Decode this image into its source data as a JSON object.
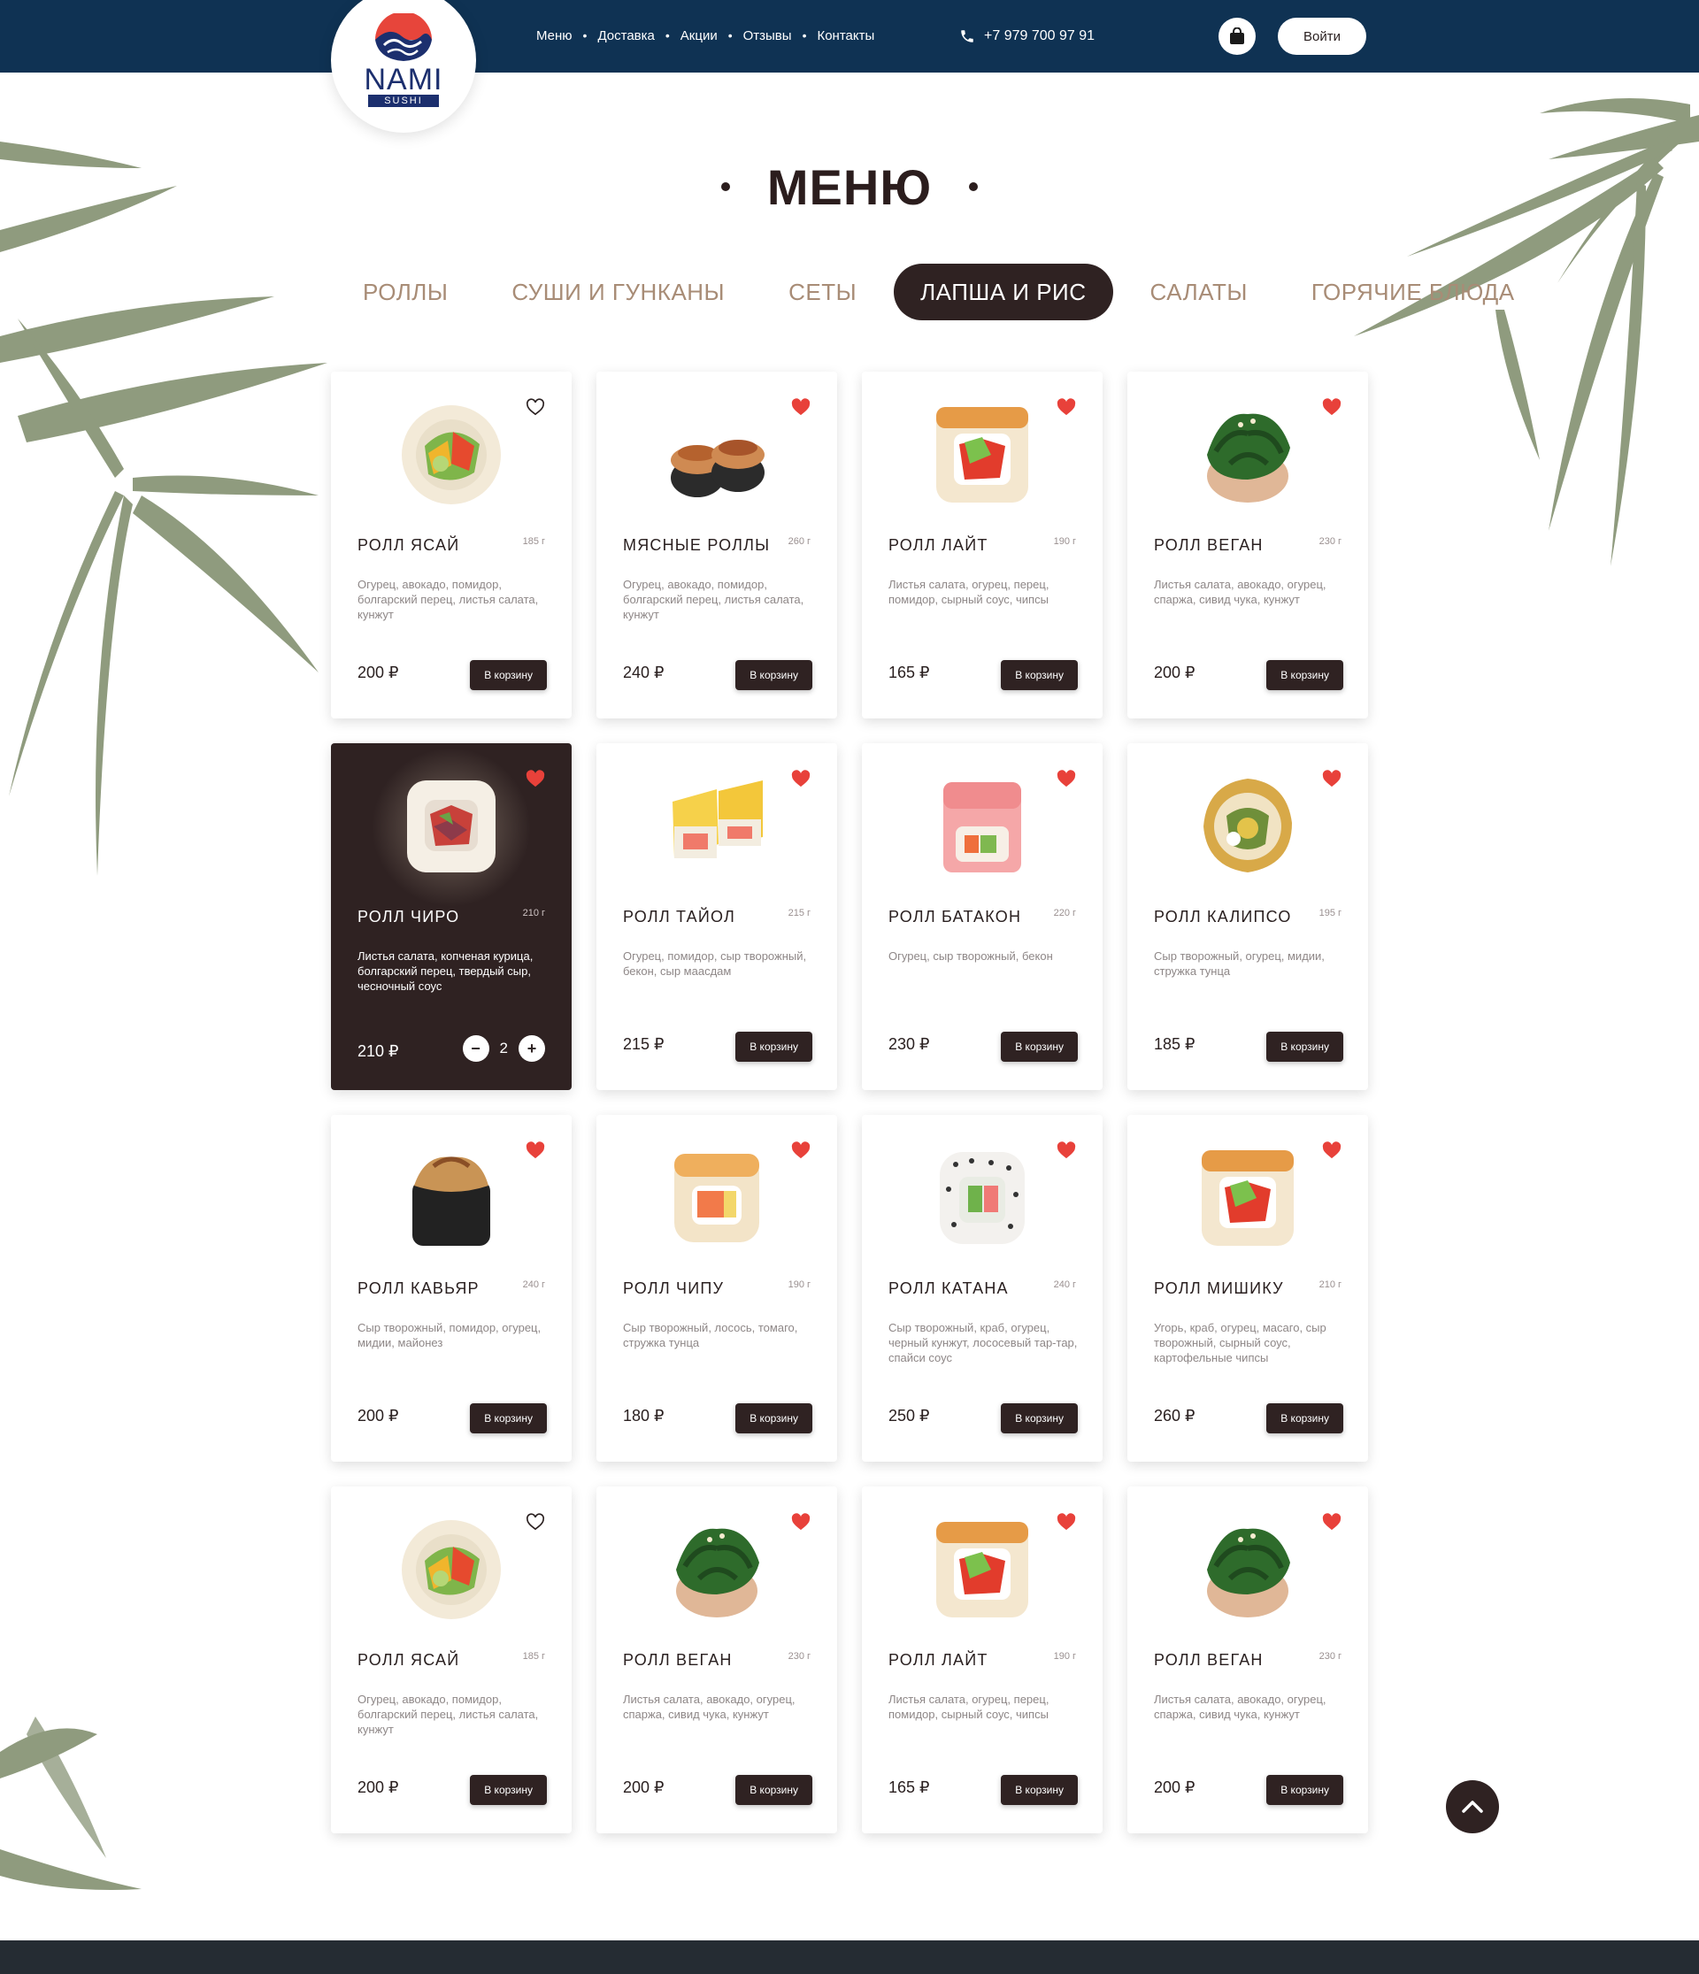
{
  "header": {
    "logo": {
      "name": "NAMI",
      "sub": "SUSHI"
    },
    "nav": [
      "Меню",
      "Доставка",
      "Акции",
      "Отзывы",
      "Контакты"
    ],
    "phone": "+7 979 700 97 91",
    "login_label": "Войти"
  },
  "page_title": "МЕНЮ",
  "tabs": [
    {
      "label": "РОЛЛЫ",
      "active": false
    },
    {
      "label": "СУШИ И ГУНКАНЫ",
      "active": false
    },
    {
      "label": "СЕТЫ",
      "active": false
    },
    {
      "label": "ЛАПША И РИС",
      "active": true
    },
    {
      "label": "САЛАТЫ",
      "active": false
    },
    {
      "label": "ГОРЯЧИЕ БЛЮДА",
      "active": false
    }
  ],
  "buy_label": "В корзину",
  "products": [
    {
      "name": "РОЛЛ ЯСАЙ",
      "weight": "185 г",
      "desc": "Огурец, авокадо, помидор, болгарский перец, листья салата, кунжут",
      "price": "200 ₽",
      "favorite": false,
      "image": "roll-vegetable"
    },
    {
      "name": "МЯСНЫЕ РОЛЛЫ",
      "weight": "260 г",
      "desc": "Огурец, авокадо, помидор, болгарский перец, листья салата, кунжут",
      "price": "240 ₽",
      "favorite": true,
      "image": "roll-meat"
    },
    {
      "name": "РОЛЛ ЛАЙТ",
      "weight": "190 г",
      "desc": "Листья салата, огурец, перец, помидор, сырный соус, чипсы",
      "price": "165 ₽",
      "favorite": true,
      "image": "roll-light"
    },
    {
      "name": "РОЛЛ ВЕГАН",
      "weight": "230 г",
      "desc": "Листья салата, авокадо, огурец, спаржа, сивид чука, кунжут",
      "price": "200 ₽",
      "favorite": true,
      "image": "roll-seaweed"
    },
    {
      "name": "РОЛЛ ЧИРО",
      "weight": "210 г",
      "desc": "Листья салата, копченая курица, болгарский перец, твердый сыр, чесночный соус",
      "price": "210 ₽",
      "favorite": true,
      "image": "roll-rice",
      "in_cart": true,
      "qty": "2"
    },
    {
      "name": "РОЛЛ ТАЙОЛ",
      "weight": "215 г",
      "desc": "Огурец, помидор, сыр творожный, бекон, сыр маасдам",
      "price": "215 ₽",
      "favorite": true,
      "image": "roll-yellow"
    },
    {
      "name": "РОЛЛ БАТАКОН",
      "weight": "220 г",
      "desc": "Огурец, сыр творожный, бекон",
      "price": "230 ₽",
      "favorite": true,
      "image": "roll-pink"
    },
    {
      "name": "РОЛЛ КАЛИПСО",
      "weight": "195 г",
      "desc": "Сыр творожный, огурец, мидии, стружка тунца",
      "price": "185 ₽",
      "favorite": true,
      "image": "roll-calypso"
    },
    {
      "name": "РОЛЛ КАВЬЯР",
      "weight": "240 г",
      "desc": "Сыр творожный, помидор, огурец, мидии, майонез",
      "price": "200 ₽",
      "favorite": true,
      "image": "roll-black"
    },
    {
      "name": "РОЛЛ ЧИПУ",
      "weight": "190 г",
      "desc": "Сыр творожный, лосось, томаго, стружка тунца",
      "price": "180 ₽",
      "favorite": true,
      "image": "roll-salmon"
    },
    {
      "name": "РОЛЛ КАТАНА",
      "weight": "240 г",
      "desc": "Сыр творожный, краб, огурец, черный кунжут, лососевый тар-тар, спайси соус",
      "price": "250 ₽",
      "favorite": true,
      "image": "roll-sesame"
    },
    {
      "name": "РОЛЛ МИШИКУ",
      "weight": "210 г",
      "desc": "Угорь, краб, огурец, масаго, сыр творожный,  сырный соус, картофельные чипсы",
      "price": "260 ₽",
      "favorite": true,
      "image": "roll-light"
    },
    {
      "name": "РОЛЛ ЯСАЙ",
      "weight": "185 г",
      "desc": "Огурец, авокадо, помидор, болгарский перец, листья салата, кунжут",
      "price": "200 ₽",
      "favorite": false,
      "image": "roll-vegetable"
    },
    {
      "name": "РОЛЛ ВЕГАН",
      "weight": "230 г",
      "desc": "Листья салата, авокадо, огурец, спаржа, сивид чука, кунжут",
      "price": "200 ₽",
      "favorite": true,
      "image": "roll-seaweed"
    },
    {
      "name": "РОЛЛ ЛАЙТ",
      "weight": "190 г",
      "desc": "Листья салата, огурец, перец, помидор, сырный соус, чипсы",
      "price": "165 ₽",
      "favorite": true,
      "image": "roll-light"
    },
    {
      "name": "РОЛЛ ВЕГАН",
      "weight": "230 г",
      "desc": "Листья салата, авокадо, огурец, спаржа, сивид чука, кунжут",
      "price": "200 ₽",
      "favorite": true,
      "image": "roll-seaweed"
    }
  ],
  "colors": {
    "header_bg": "#0f3253",
    "accent_dark": "#2f2222",
    "tab_inactive": "#a88c76",
    "heart": "#e8413a",
    "footer_bg": "#252c33"
  },
  "icons": {
    "phone": "phone-icon",
    "cart": "shopping-bag-icon",
    "favorite": "heart-icon",
    "scroll_top": "chevron-up-icon"
  }
}
